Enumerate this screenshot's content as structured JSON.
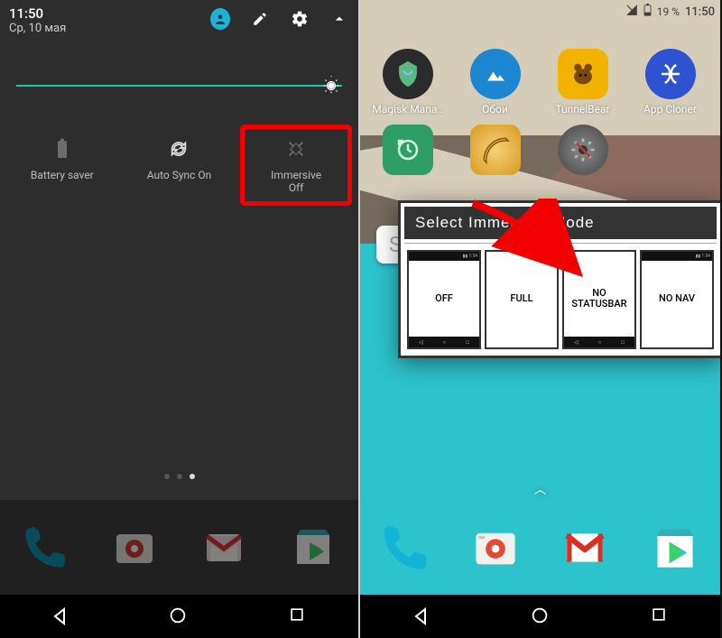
{
  "left": {
    "status": {
      "time": "11:50",
      "date": "Ср, 10 мая"
    },
    "tiles": [
      {
        "id": "battery-saver",
        "label": "Battery saver",
        "line2": ""
      },
      {
        "id": "auto-sync",
        "label": "Auto Sync On",
        "line2": ""
      },
      {
        "id": "immersive",
        "label": "Immersive",
        "line2": "Off",
        "highlighted": true
      }
    ],
    "brightness": {
      "value": 100
    },
    "page_indicator": {
      "total": 3,
      "active_index": 2
    }
  },
  "right": {
    "status": {
      "battery_pct": "19 %",
      "time": "11:50"
    },
    "apps_row1": [
      {
        "id": "magisk",
        "label": "Magisk Mana..",
        "color": "#2b2b2b"
      },
      {
        "id": "oboi",
        "label": "Обои",
        "color": "#1d86d1"
      },
      {
        "id": "tunnelbear",
        "label": "TunnelBear",
        "color": "#f2b300"
      },
      {
        "id": "appcloner",
        "label": "App Cloner",
        "color": "#2f52d1"
      }
    ],
    "apps_row2": [
      {
        "id": "backup",
        "label": "",
        "color": "#2e9d66"
      },
      {
        "id": "ruler",
        "label": "",
        "color": "#f0b13a"
      },
      {
        "id": "settings2",
        "label": "",
        "color": "#575757"
      }
    ]
  },
  "dialog": {
    "title": "Select Immersive Mode",
    "options": [
      {
        "id": "off",
        "text": "OFF",
        "show_status": true,
        "show_nav": true
      },
      {
        "id": "full",
        "text": "FULL",
        "show_status": false,
        "show_nav": false
      },
      {
        "id": "nostat",
        "text": "NO\nSTATUSBAR",
        "show_status": false,
        "show_nav": true
      },
      {
        "id": "nonav",
        "text": "NO NAV",
        "show_status": true,
        "show_nav": false
      }
    ]
  },
  "dock_apps": [
    "phone",
    "camera",
    "gmail",
    "play"
  ],
  "nav_buttons": [
    "back",
    "home",
    "recent"
  ]
}
